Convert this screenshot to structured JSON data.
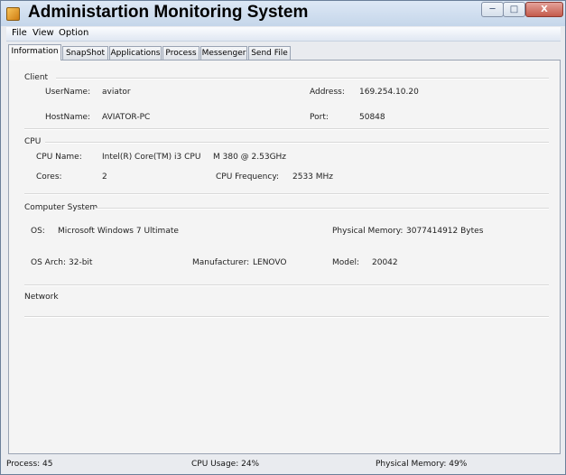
{
  "window": {
    "title": "Administartion Monitoring System",
    "icon": "java-cup-icon"
  },
  "controls": {
    "minimize": "─",
    "maximize": "□",
    "close": "X"
  },
  "menu": [
    "File",
    "View",
    "Option"
  ],
  "tabs": [
    "Information",
    "SnapShot",
    "Applications",
    "Process",
    "Messenger",
    "Send File"
  ],
  "client": {
    "heading": "Client",
    "username_label": "UserName:",
    "username": "aviator",
    "address_label": "Address:",
    "address": "169.254.10.20",
    "hostname_label": "HostName:",
    "hostname": "AVIATOR-PC",
    "port_label": "Port:",
    "port": "50848"
  },
  "cpu": {
    "heading": "CPU",
    "name_label": "CPU Name:",
    "name": "Intel(R) Core(TM) i3 CPU",
    "model_text": "M 380  @ 2.53GHz",
    "cores_label": "Cores:",
    "cores": "2",
    "freq_label": "CPU Frequency:",
    "freq": "2533 MHz"
  },
  "system": {
    "heading": "Computer System",
    "os_label": "OS:",
    "os": "Microsoft Windows 7 Ultimate",
    "mem_label": "Physical Memory:",
    "mem": "3077414912 Bytes",
    "arch_label": "OS Arch:",
    "arch": "32-bit",
    "manuf_label": "Manufacturer:",
    "manuf": "LENOVO",
    "model_label": "Model:",
    "model": "20042"
  },
  "network": {
    "heading": "Network"
  },
  "status": {
    "process": "Process: 45",
    "cpu": "CPU Usage: 24%",
    "memory": "Physical Memory: 49%"
  }
}
